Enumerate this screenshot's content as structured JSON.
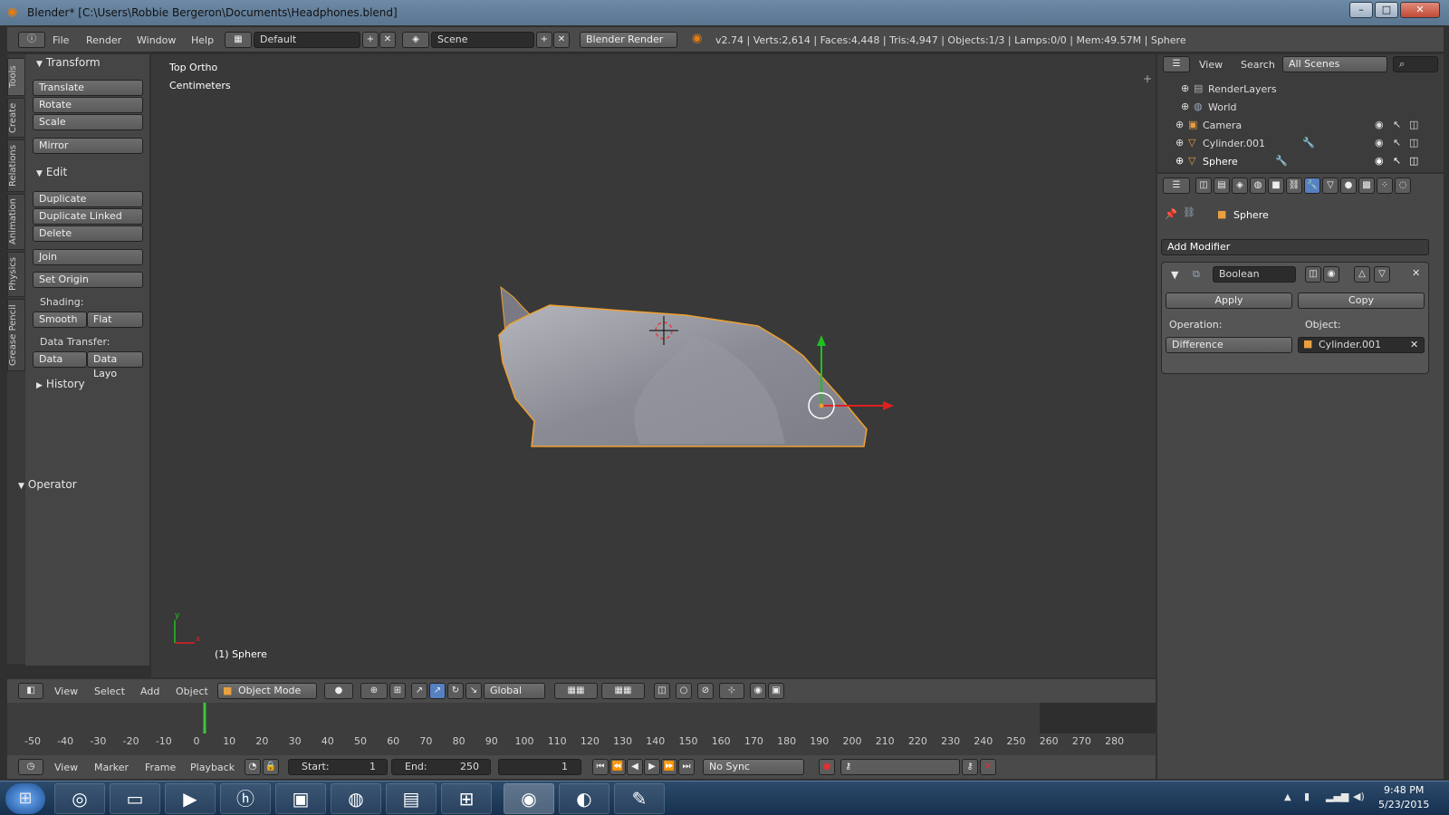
{
  "window": {
    "title": "Blender* [C:\\Users\\Robbie Bergeron\\Documents\\Headphones.blend]",
    "minimize": "–",
    "maximize": "□",
    "close": "✕"
  },
  "info": {
    "menus": [
      "File",
      "Render",
      "Window",
      "Help"
    ],
    "layout": "Default",
    "scene": "Scene",
    "engine": "Blender Render",
    "stats": "v2.74 | Verts:2,614 | Faces:4,448 | Tris:4,947 | Objects:1/3 | Lamps:0/0 | Mem:49.57M | Sphere"
  },
  "tool_tabs": [
    "Tools",
    "Create",
    "Relations",
    "Animation",
    "Physics",
    "Grease Pencil"
  ],
  "tools": {
    "transform_header": "Transform",
    "translate": "Translate",
    "rotate": "Rotate",
    "scale": "Scale",
    "mirror": "Mirror",
    "edit_header": "Edit",
    "duplicate": "Duplicate",
    "duplicate_linked": "Duplicate Linked",
    "delete": "Delete",
    "join": "Join",
    "set_origin": "Set Origin",
    "shading_label": "Shading:",
    "smooth": "Smooth",
    "flat": "Flat",
    "data_transfer_label": "Data Transfer:",
    "data": "Data",
    "data_layo": "Data Layo",
    "history_header": "History",
    "operator_header": "Operator"
  },
  "viewport": {
    "view_name": "Top Ortho",
    "units": "Centimeters",
    "object_label": "(1) Sphere",
    "axis_x": "x",
    "axis_y": "y"
  },
  "vp_header": {
    "menus": [
      "View",
      "Select",
      "Add",
      "Object"
    ],
    "mode": "Object Mode",
    "orientation": "Global"
  },
  "timeline": {
    "ticks": [
      "-50",
      "-40",
      "-30",
      "-20",
      "-10",
      "0",
      "10",
      "20",
      "30",
      "40",
      "50",
      "60",
      "70",
      "80",
      "90",
      "100",
      "110",
      "120",
      "130",
      "140",
      "150",
      "160",
      "170",
      "180",
      "190",
      "200",
      "210",
      "220",
      "230",
      "240",
      "250",
      "260",
      "270",
      "280"
    ],
    "menus": [
      "View",
      "Marker",
      "Frame",
      "Playback"
    ],
    "start_label": "Start:",
    "start_value": "1",
    "end_label": "End:",
    "end_value": "250",
    "current_frame": "1",
    "sync": "No Sync"
  },
  "outliner": {
    "menus": [
      "View",
      "Search"
    ],
    "scenes": "All Scenes",
    "items": [
      "RenderLayers",
      "World",
      "Camera",
      "Cylinder.001",
      "Sphere"
    ]
  },
  "properties": {
    "context": "Sphere",
    "add_modifier": "Add Modifier",
    "modifier_name": "Boolean",
    "apply": "Apply",
    "copy": "Copy",
    "operation_label": "Operation:",
    "operation": "Difference",
    "object_label": "Object:",
    "object": "Cylinder.001"
  },
  "taskbar": {
    "time": "9:48 PM",
    "date": "5/23/2015"
  },
  "colors": {
    "accent": "#5680c2",
    "selection_outline": "#f0a030",
    "mesh": "#8f8f99"
  }
}
